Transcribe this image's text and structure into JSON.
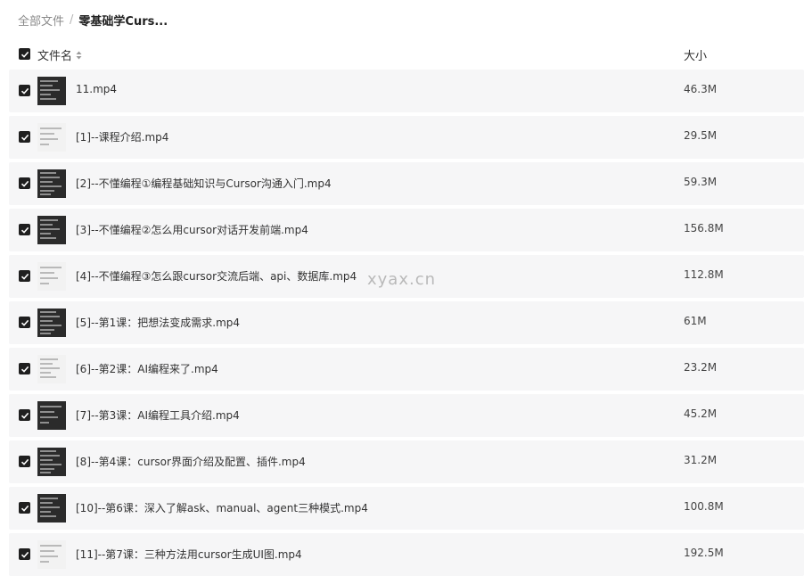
{
  "breadcrumb": {
    "root": "全部文件",
    "separator": "/",
    "current": "零基础学Curs..."
  },
  "header": {
    "name_label": "文件名",
    "size_label": "大小",
    "sort_icon": "sort-arrows-icon"
  },
  "files": [
    {
      "name": "11.mp4",
      "size": "46.3M",
      "thumb": "dark"
    },
    {
      "name": "[1]--课程介绍.mp4",
      "size": "29.5M",
      "thumb": "light"
    },
    {
      "name": "[2]--不懂编程①编程基础知识与Cursor沟通入门.mp4",
      "size": "59.3M",
      "thumb": "dark"
    },
    {
      "name": "[3]--不懂编程②怎么用cursor对话开发前端.mp4",
      "size": "156.8M",
      "thumb": "dark"
    },
    {
      "name": "[4]--不懂编程③怎么跟cursor交流后端、api、数据库.mp4",
      "size": "112.8M",
      "thumb": "light"
    },
    {
      "name": "[5]--第1课：把想法变成需求.mp4",
      "size": "61M",
      "thumb": "dark"
    },
    {
      "name": "[6]--第2课：AI编程来了.mp4",
      "size": "23.2M",
      "thumb": "light"
    },
    {
      "name": "[7]--第3课：AI编程工具介绍.mp4",
      "size": "45.2M",
      "thumb": "dark"
    },
    {
      "name": "[8]--第4课：cursor界面介绍及配置、插件.mp4",
      "size": "31.2M",
      "thumb": "dark"
    },
    {
      "name": "[10]--第6课：深入了解ask、manual、agent三种模式.mp4",
      "size": "100.8M",
      "thumb": "dark"
    },
    {
      "name": "[11]--第7课：三种方法用cursor生成UI图.mp4",
      "size": "192.5M",
      "thumb": "light"
    }
  ],
  "watermark": "xyax.cn",
  "colors": {
    "checkbox": "#1f1f1f",
    "row_background": "#f6f6f7",
    "text": "#333333",
    "muted": "#8a8a8a"
  }
}
